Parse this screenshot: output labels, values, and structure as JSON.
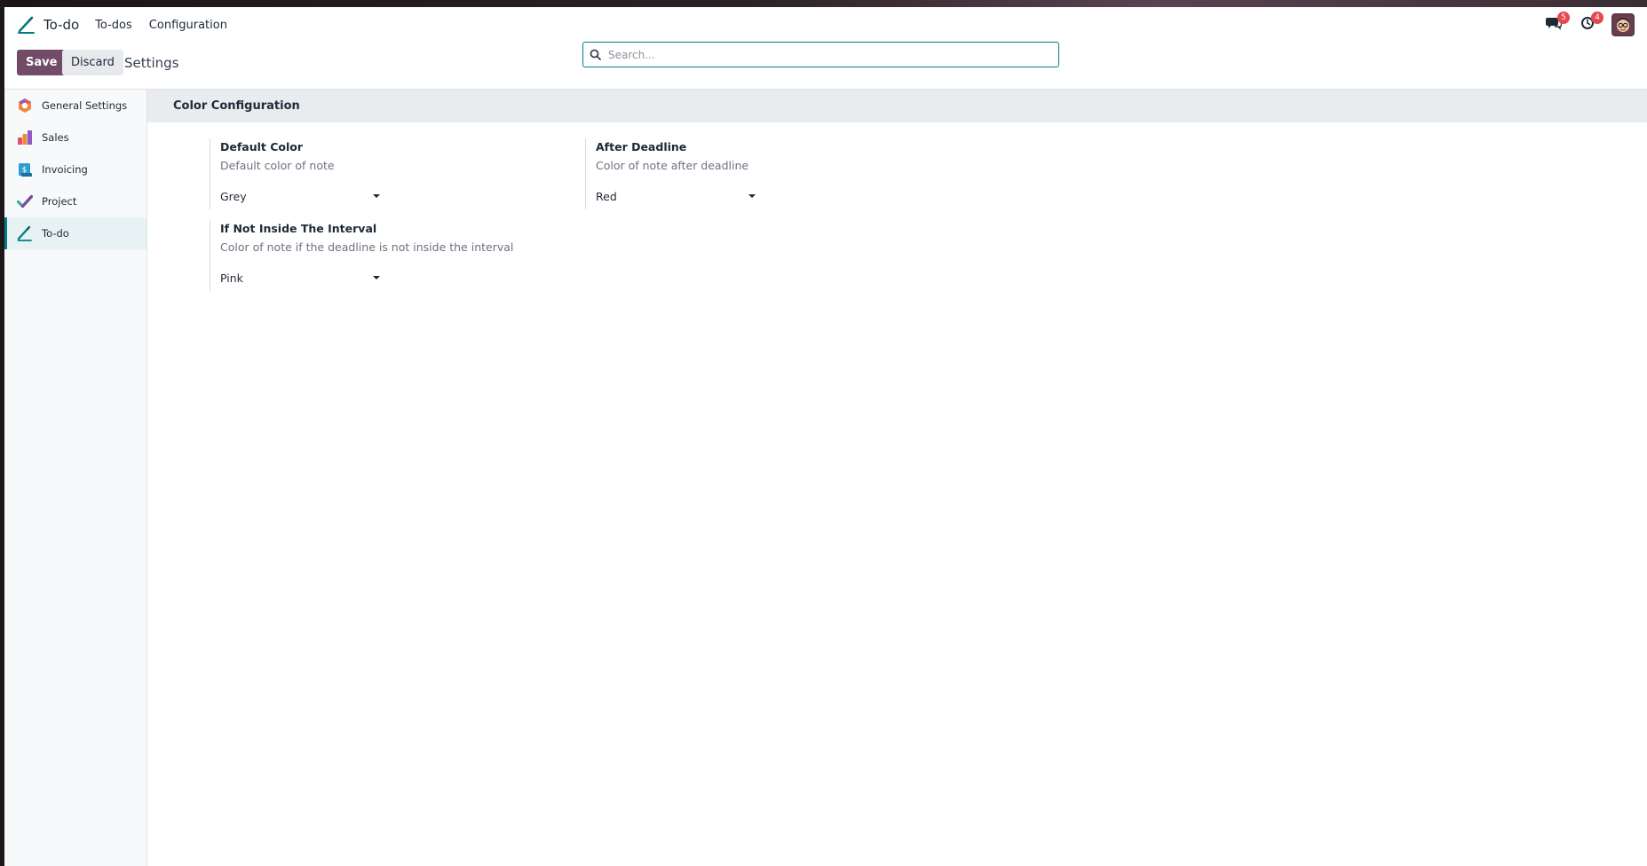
{
  "navbar": {
    "app_name": "To-do",
    "menus": [
      "To-dos",
      "Configuration"
    ],
    "messages_count": "5",
    "activities_count": "4"
  },
  "control_panel": {
    "save_label": "Save",
    "discard_label": "Discard",
    "title": "Settings"
  },
  "search": {
    "placeholder": "Search..."
  },
  "sidebar": {
    "items": [
      {
        "label": "General Settings",
        "icon": "general-settings-icon"
      },
      {
        "label": "Sales",
        "icon": "sales-icon"
      },
      {
        "label": "Invoicing",
        "icon": "invoicing-icon"
      },
      {
        "label": "Project",
        "icon": "project-icon"
      },
      {
        "label": "To-do",
        "icon": "todo-icon",
        "active": true
      }
    ]
  },
  "section": {
    "title": "Color Configuration",
    "settings": [
      {
        "title": "Default Color",
        "description": "Default color of note",
        "value": "Grey"
      },
      {
        "title": "After Deadline",
        "description": "Color of note after deadline",
        "value": "Red"
      },
      {
        "title": "If Not Inside The Interval",
        "description": "Color of note if the deadline is not inside the interval",
        "value": "Pink"
      }
    ]
  },
  "colors": {
    "brand": "#714b67",
    "accent": "#017e84",
    "badge": "#e5484d"
  }
}
